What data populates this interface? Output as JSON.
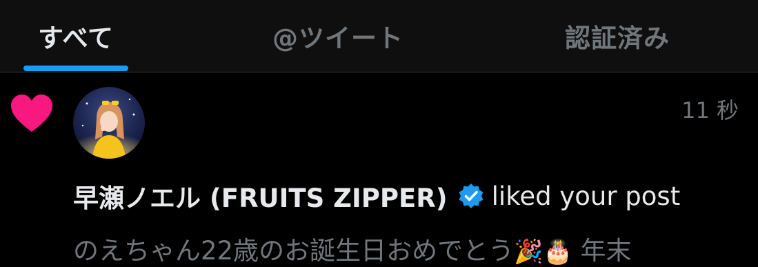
{
  "tabs": [
    {
      "label": "すべて",
      "active": true
    },
    {
      "label": "@ツイート",
      "active": false
    },
    {
      "label": "認証済み",
      "active": false
    }
  ],
  "notification": {
    "type_icon": "heart-icon",
    "time": "11 秒",
    "user_name": "早瀬ノエル (FRUITS ZIPPER)",
    "verified_icon": "verified-badge-icon",
    "action_text": "liked your post",
    "preview_text": "のえちゃん22歳のお誕生日おめでとう",
    "preview_emojis": [
      "🎉",
      "🎂"
    ],
    "preview_tail": "年末"
  },
  "colors": {
    "accent": "#1d9bf0",
    "heart": "#f91880",
    "muted": "#71767b"
  }
}
